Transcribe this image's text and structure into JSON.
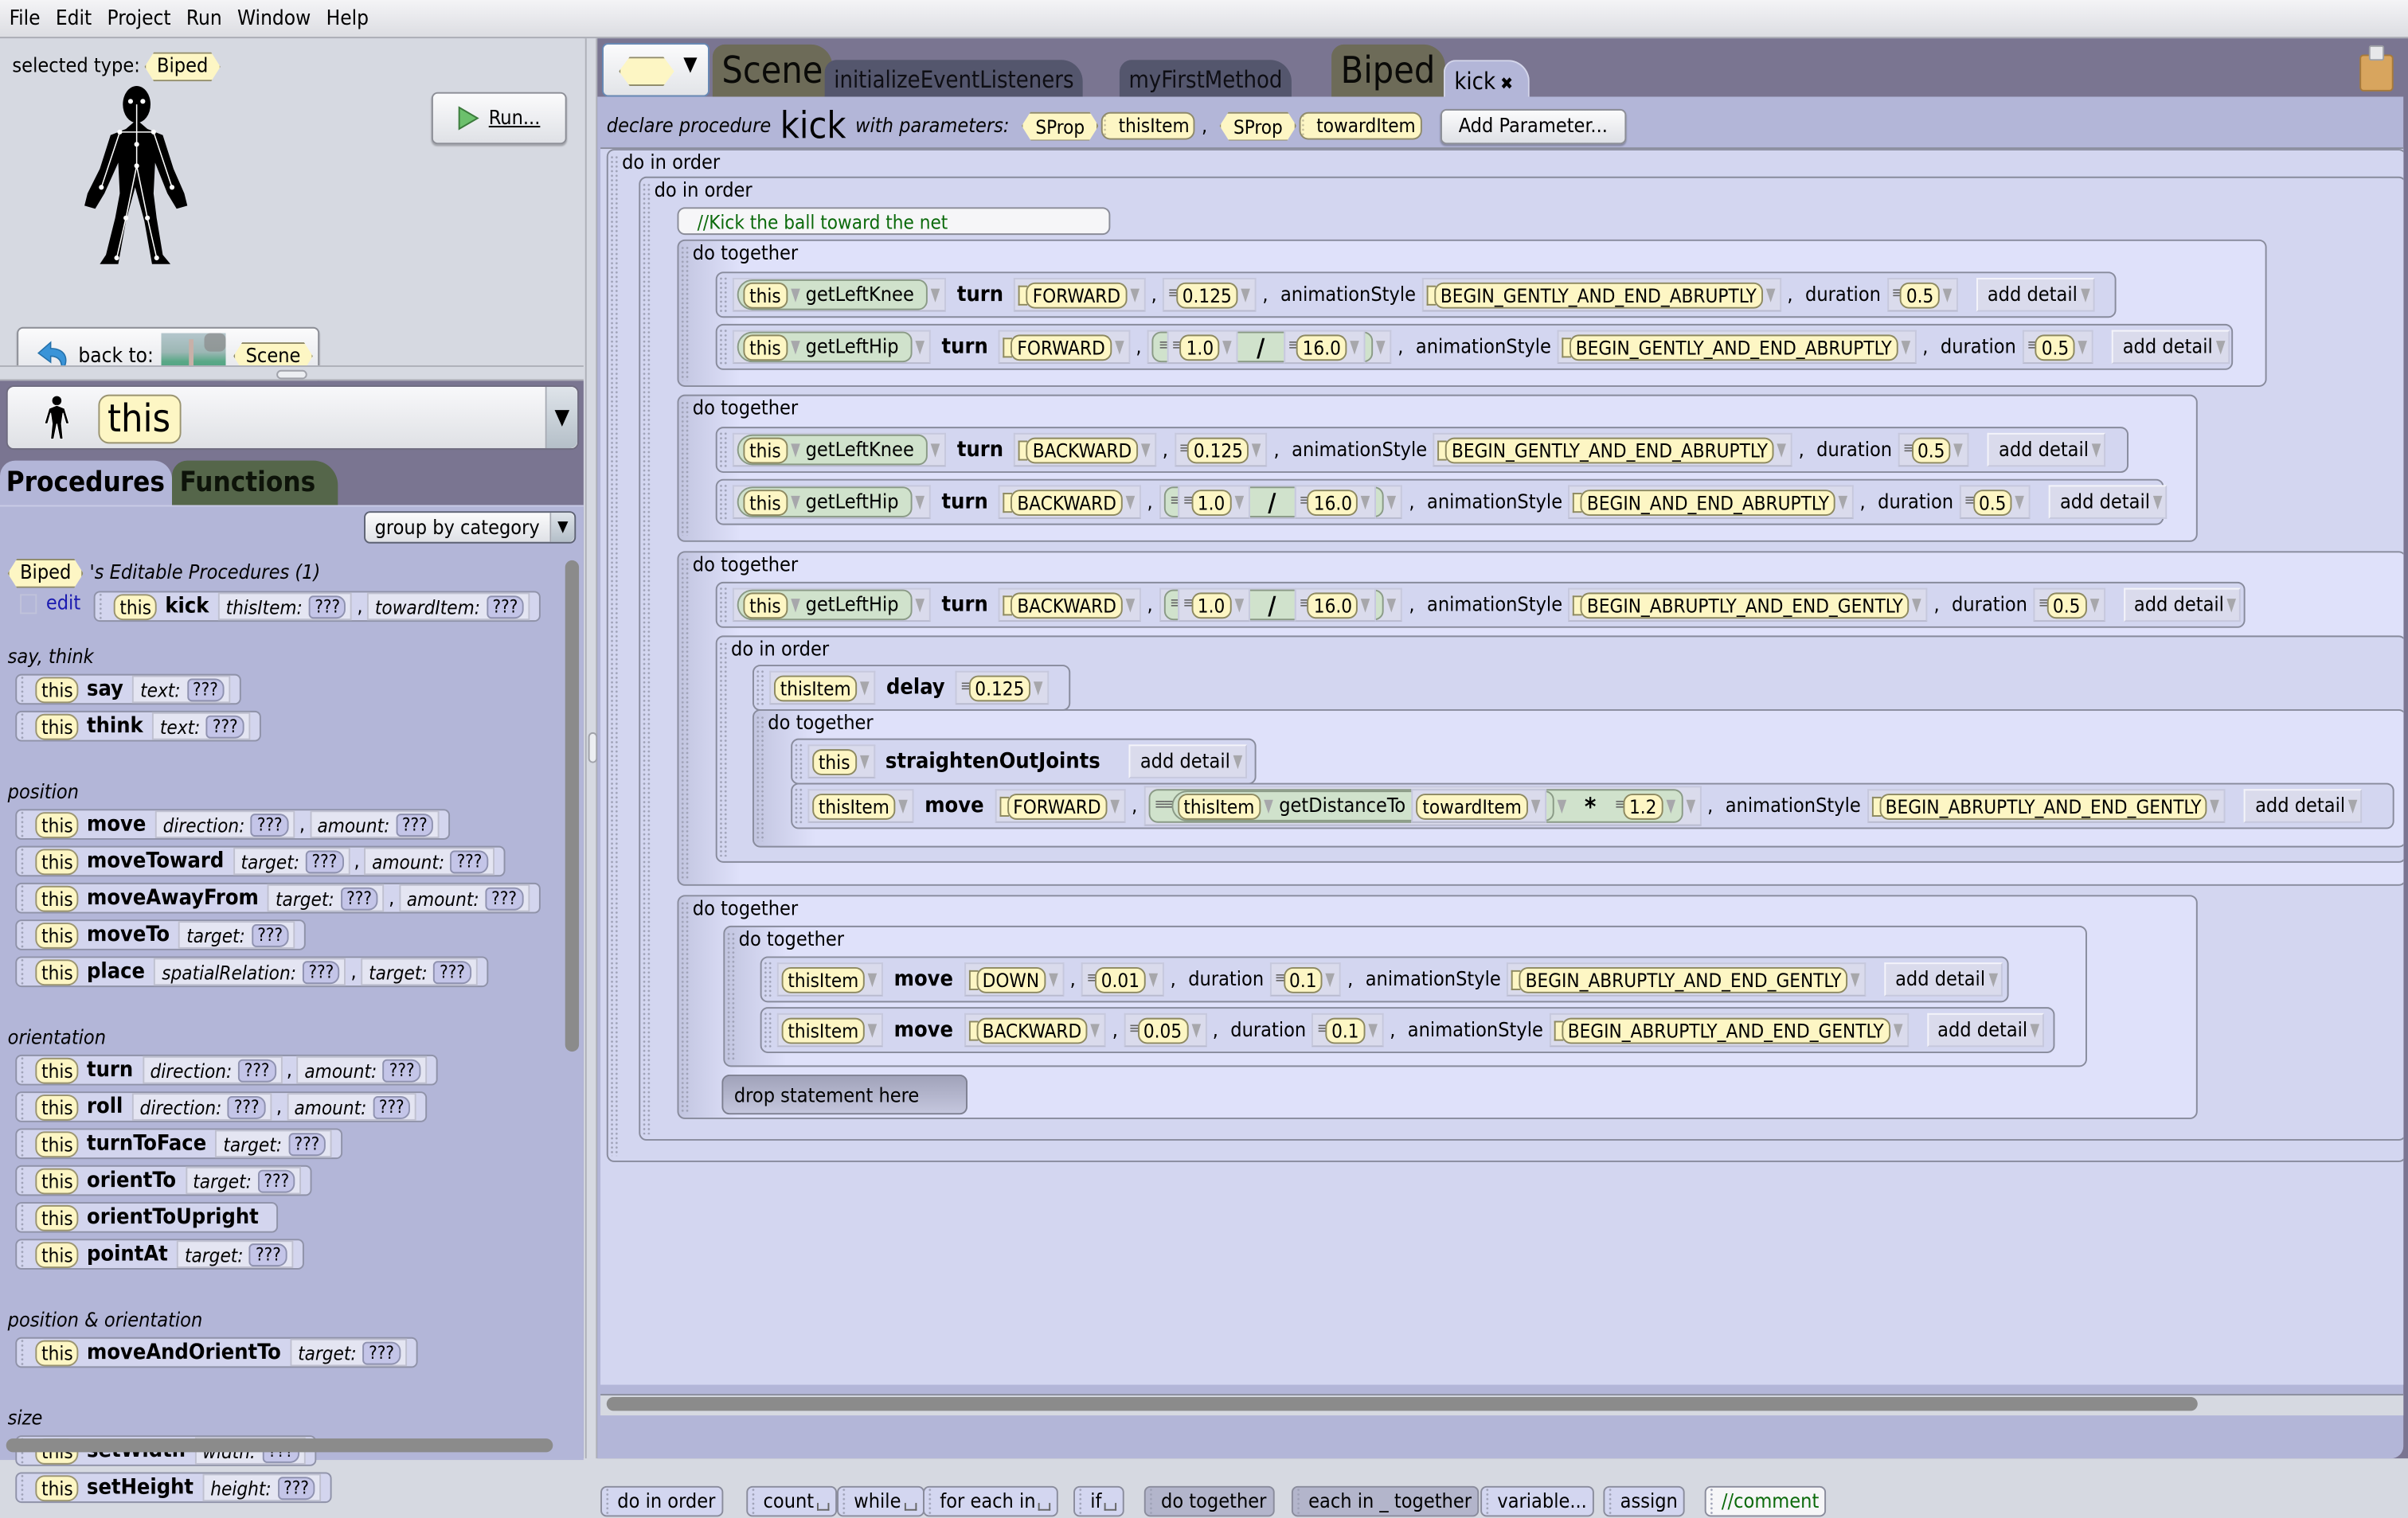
{
  "menu": [
    "File",
    "Edit",
    "Project",
    "Run",
    "Window",
    "Help"
  ],
  "left_top": {
    "selected_type_label": "selected type:",
    "selected_type": "Biped",
    "run_label": "Run...",
    "back_to_label": "back to:",
    "back_to_target": "Scene"
  },
  "instance_selector": {
    "value": "this"
  },
  "member_tabs": {
    "procedures": "Procedures",
    "functions": "Functions"
  },
  "group_by": "group by category",
  "editable_header": {
    "type": "Biped",
    "text": "'s Editable Procedures (1)"
  },
  "editable_proc": {
    "edit_link": "edit",
    "this": "this",
    "name": "kick",
    "params": [
      {
        "label": "thisItem:",
        "value": "???"
      },
      {
        "label": "towardItem:",
        "value": "???"
      }
    ]
  },
  "categories": [
    {
      "name": "say, think",
      "procs": [
        {
          "name": "say",
          "params": [
            {
              "label": "text:",
              "value": "???"
            }
          ]
        },
        {
          "name": "think",
          "params": [
            {
              "label": "text:",
              "value": "???"
            }
          ]
        }
      ]
    },
    {
      "name": "position",
      "procs": [
        {
          "name": "move",
          "params": [
            {
              "label": "direction:",
              "value": "???"
            },
            {
              "label": "amount:",
              "value": "???"
            }
          ]
        },
        {
          "name": "moveToward",
          "params": [
            {
              "label": "target:",
              "value": "???"
            },
            {
              "label": "amount:",
              "value": "???"
            }
          ]
        },
        {
          "name": "moveAwayFrom",
          "params": [
            {
              "label": "target:",
              "value": "???"
            },
            {
              "label": "amount:",
              "value": "???"
            }
          ]
        },
        {
          "name": "moveTo",
          "params": [
            {
              "label": "target:",
              "value": "???"
            }
          ]
        },
        {
          "name": "place",
          "params": [
            {
              "label": "spatialRelation:",
              "value": "???"
            },
            {
              "label": "target:",
              "value": "???"
            }
          ]
        }
      ]
    },
    {
      "name": "orientation",
      "procs": [
        {
          "name": "turn",
          "params": [
            {
              "label": "direction:",
              "value": "???"
            },
            {
              "label": "amount:",
              "value": "???"
            }
          ]
        },
        {
          "name": "roll",
          "params": [
            {
              "label": "direction:",
              "value": "???"
            },
            {
              "label": "amount:",
              "value": "???"
            }
          ]
        },
        {
          "name": "turnToFace",
          "params": [
            {
              "label": "target:",
              "value": "???"
            }
          ]
        },
        {
          "name": "orientTo",
          "params": [
            {
              "label": "target:",
              "value": "???"
            }
          ]
        },
        {
          "name": "orientToUpright",
          "params": []
        },
        {
          "name": "pointAt",
          "params": [
            {
              "label": "target:",
              "value": "???"
            }
          ]
        }
      ]
    },
    {
      "name": "position & orientation",
      "procs": [
        {
          "name": "moveAndOrientTo",
          "params": [
            {
              "label": "target:",
              "value": "???"
            }
          ]
        }
      ]
    },
    {
      "name": "size",
      "procs": [
        {
          "name": "setWidth",
          "params": [
            {
              "label": "width:",
              "value": "???"
            }
          ]
        },
        {
          "name": "setHeight",
          "params": [
            {
              "label": "height:",
              "value": "???"
            }
          ]
        }
      ]
    }
  ],
  "editor_tabs": [
    {
      "label": "Scene",
      "kind": "type"
    },
    {
      "label": "initializeEventListeners",
      "kind": "method"
    },
    {
      "label": "myFirstMethod",
      "kind": "method"
    },
    {
      "label": "Biped",
      "kind": "type"
    },
    {
      "label": "kick",
      "kind": "active",
      "closable": true
    }
  ],
  "declaration": {
    "prefix": "declare procedure",
    "name": "kick",
    "with": "with parameters:",
    "params": [
      {
        "type": "SProp",
        "name": "thisItem"
      },
      {
        "type": "SProp",
        "name": "towardItem"
      }
    ],
    "add_parameter": "Add Parameter..."
  },
  "code": {
    "do_in_order": "do in order",
    "do_together": "do together",
    "comment": "//Kick the ball toward the net",
    "drop_statement": "drop statement here",
    "add_detail": "add detail",
    "animationStyle": "animationStyle",
    "duration": "duration",
    "statements": [
      {
        "target": "this",
        "getter": "getLeftKnee",
        "proc": "turn",
        "dir": "FORWARD",
        "amount": "0.125",
        "style": "BEGIN_GENTLY_AND_END_ABRUPTLY",
        "duration": "0.5"
      },
      {
        "target": "this",
        "getter": "getLeftHip",
        "proc": "turn",
        "dir": "FORWARD",
        "amount_a": "1.0",
        "amount_op": "/",
        "amount_b": "16.0",
        "style": "BEGIN_GENTLY_AND_END_ABRUPTLY",
        "duration": "0.5"
      },
      {
        "target": "this",
        "getter": "getLeftKnee",
        "proc": "turn",
        "dir": "BACKWARD",
        "amount": "0.125",
        "style": "BEGIN_GENTLY_AND_END_ABRUPTLY",
        "duration": "0.5"
      },
      {
        "target": "this",
        "getter": "getLeftHip",
        "proc": "turn",
        "dir": "BACKWARD",
        "amount_a": "1.0",
        "amount_op": "/",
        "amount_b": "16.0",
        "style": "BEGIN_AND_END_ABRUPTLY",
        "duration": "0.5"
      },
      {
        "target": "this",
        "getter": "getLeftHip",
        "proc": "turn",
        "dir": "BACKWARD",
        "amount_a": "1.0",
        "amount_op": "/",
        "amount_b": "16.0",
        "style": "BEGIN_ABRUPTLY_AND_END_GENTLY",
        "duration": "0.5"
      },
      {
        "target": "thisItem",
        "proc": "delay",
        "amount": "0.125"
      },
      {
        "target": "this",
        "proc": "straightenOutJoints"
      },
      {
        "target": "thisItem",
        "proc": "move",
        "dir": "FORWARD",
        "fn_target": "thisItem",
        "fn": "getDistanceTo",
        "fn_arg": "towardItem",
        "op": "*",
        "factor": "1.2",
        "style": "BEGIN_ABRUPTLY_AND_END_GENTLY"
      },
      {
        "target": "thisItem",
        "proc": "move",
        "dir": "DOWN",
        "amount": "0.01",
        "duration": "0.1",
        "style": "BEGIN_ABRUPTLY_AND_END_GENTLY"
      },
      {
        "target": "thisItem",
        "proc": "move",
        "dir": "BACKWARD",
        "amount": "0.05",
        "duration": "0.1",
        "style": "BEGIN_ABRUPTLY_AND_END_GENTLY"
      }
    ]
  },
  "toolbar": [
    {
      "label": "do in order",
      "style": "normal",
      "blank": false
    },
    {
      "label": "count",
      "style": "normal",
      "blank": true
    },
    {
      "label": "while",
      "style": "normal",
      "blank": true
    },
    {
      "label": "for each in",
      "style": "normal",
      "blank": true
    },
    {
      "label": "if",
      "style": "normal",
      "blank": true
    },
    {
      "label": "do together",
      "style": "dark",
      "blank": false
    },
    {
      "label": "each in _ together",
      "style": "dark",
      "blank": false
    },
    {
      "label": "variable...",
      "style": "normal",
      "blank": false
    },
    {
      "label": "assign",
      "style": "normal",
      "blank": false
    },
    {
      "label": "//comment",
      "style": "comment",
      "blank": false
    }
  ],
  "colors": {
    "panel_purple": "#7a7591",
    "code_bg": "#d3d6f0",
    "type_tag": "#fdf6c4",
    "function_tab": "#55664a",
    "comment_green": "#0b6a0b"
  }
}
